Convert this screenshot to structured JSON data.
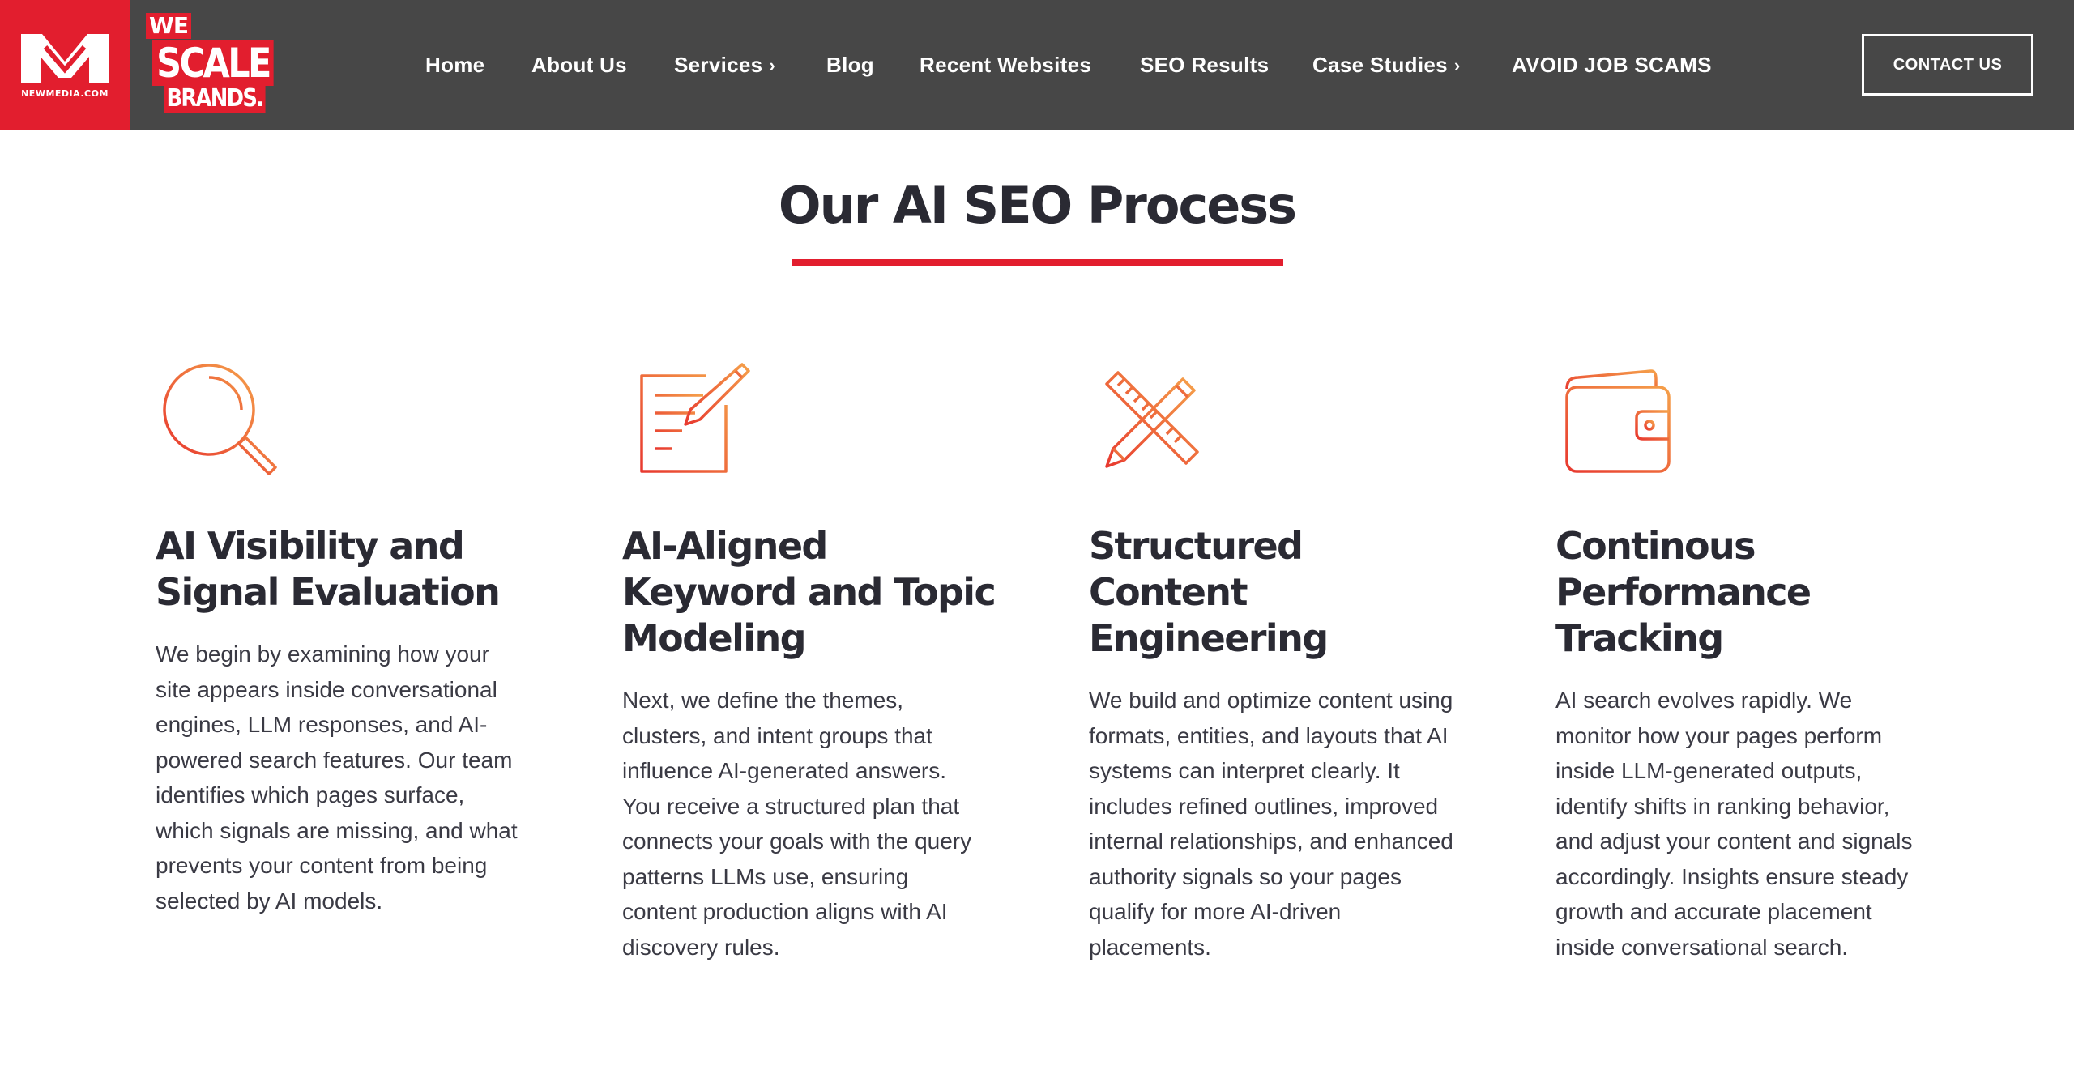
{
  "header": {
    "logo_nm_text": "NEWMEDIA.COM",
    "logo_we": "WE",
    "logo_scale": "SCALE",
    "logo_brands": "BRANDS.",
    "nav": [
      {
        "label": "Home",
        "has_submenu": false
      },
      {
        "label": "About Us",
        "has_submenu": false
      },
      {
        "label": "Services",
        "has_submenu": true
      },
      {
        "label": "Blog",
        "has_submenu": false
      },
      {
        "label": "Recent Websites",
        "has_submenu": false
      },
      {
        "label": "SEO Results",
        "has_submenu": false
      },
      {
        "label": "Case Studies",
        "has_submenu": true
      },
      {
        "label": "AVOID JOB SCAMS",
        "has_submenu": false
      }
    ],
    "submenu_glyph": "›",
    "contact_label": "CONTACT US"
  },
  "colors": {
    "brand_red": "#e21e2e",
    "header_bg": "#474747",
    "icon_gradient_start": "#e8392f",
    "icon_gradient_end": "#f5a04a",
    "heading": "#2a2a33"
  },
  "section": {
    "title": "Our AI SEO Process",
    "steps": [
      {
        "icon": "magnifier-icon",
        "title": "AI Visibility and Signal Evaluation",
        "body": "We begin by examining how your site appears inside conversational engines, LLM responses, and AI-powered search features. Our team identifies which pages surface, which signals are missing, and what prevents your content from being selected by AI models."
      },
      {
        "icon": "document-pencil-icon",
        "title": "AI-Aligned Keyword and Topic Modeling",
        "body": "Next, we define the themes, clusters, and intent groups that influence AI-generated answers. You receive a structured plan that connects your goals with the query patterns LLMs use, ensuring content production aligns with AI discovery rules."
      },
      {
        "icon": "pencil-ruler-icon",
        "title": "Structured Content Engineering",
        "body": "We build and optimize content using formats, entities, and layouts that AI systems can interpret clearly. It includes refined outlines, improved internal relationships, and enhanced authority signals so your pages qualify for more AI-driven placements."
      },
      {
        "icon": "wallet-icon",
        "title": "Continous Performance Tracking",
        "body": "AI search evolves rapidly. We monitor how your pages perform inside LLM-generated outputs, identify shifts in ranking behavior, and adjust your content and signals accordingly. Insights ensure steady growth and accurate placement inside conversational search."
      }
    ]
  }
}
